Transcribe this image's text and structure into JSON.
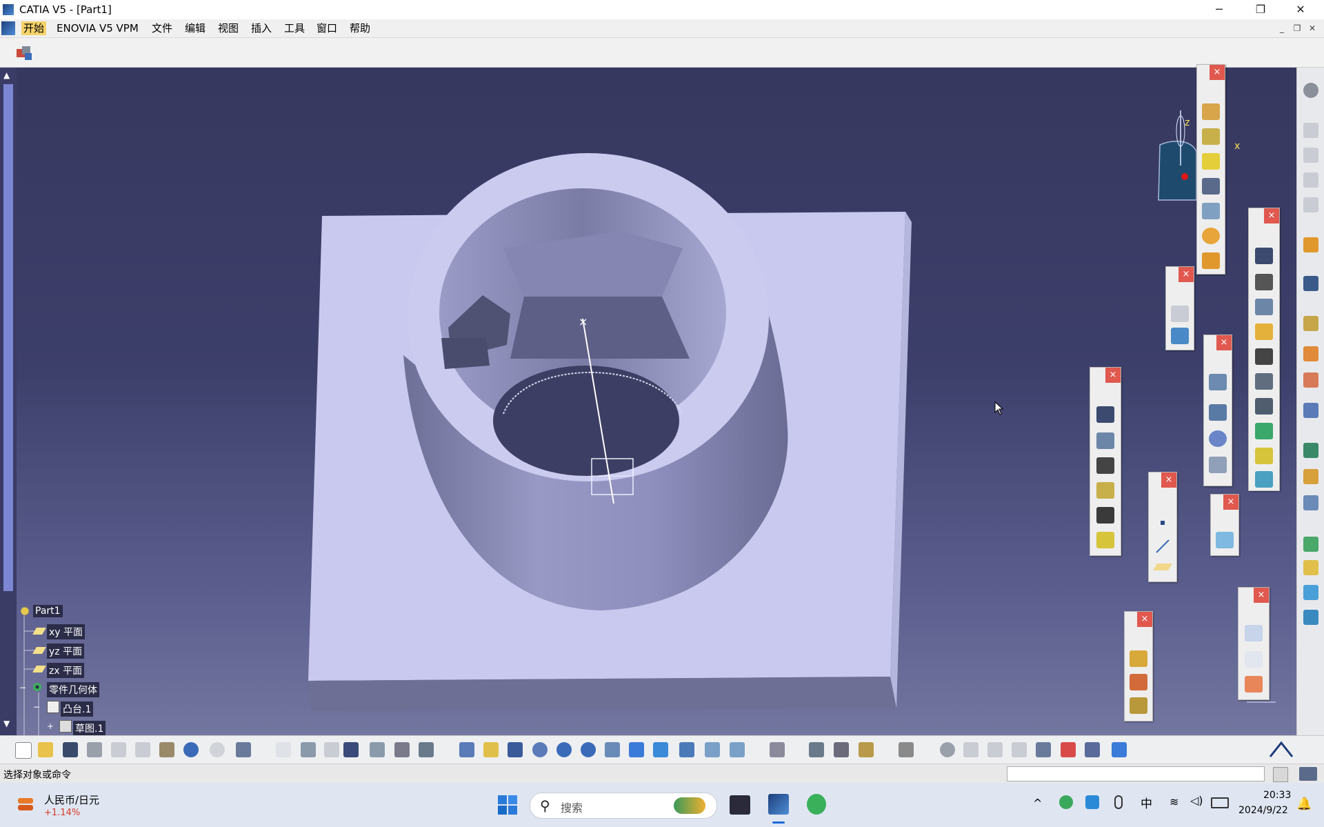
{
  "window": {
    "title": "CATIA V5 - [Part1]",
    "minimize": "─",
    "restore": "❐",
    "close": "✕"
  },
  "menu": {
    "items": [
      "开始",
      "ENOVIA V5 VPM",
      "文件",
      "编辑",
      "视图",
      "插入",
      "工具",
      "窗口",
      "帮助"
    ],
    "mdi_min": "_",
    "mdi_restore": "❐",
    "mdi_close": "✕"
  },
  "tree": {
    "root": "Part1",
    "xy": "xy 平面",
    "yz": "yz 平面",
    "zx": "zx 平面",
    "body": "零件几何体",
    "pad": "凸台.1",
    "sketch": "草图.1"
  },
  "compass": {
    "x_label": "x",
    "z_label": "z"
  },
  "palettes": {
    "close": "×"
  },
  "status": {
    "prompt": "选择对象或命令"
  },
  "taskbar": {
    "widget_title": "人民币/日元",
    "widget_change": "+1.14%",
    "search_placeholder": "搜索",
    "time": "20:33",
    "date": "2024/9/22",
    "ime": "中"
  },
  "colors": {
    "accent_menu": "#f6d36a",
    "viewport_top": "#36385f",
    "part_face": "#c8c8ee",
    "close_red": "#e0584e"
  }
}
